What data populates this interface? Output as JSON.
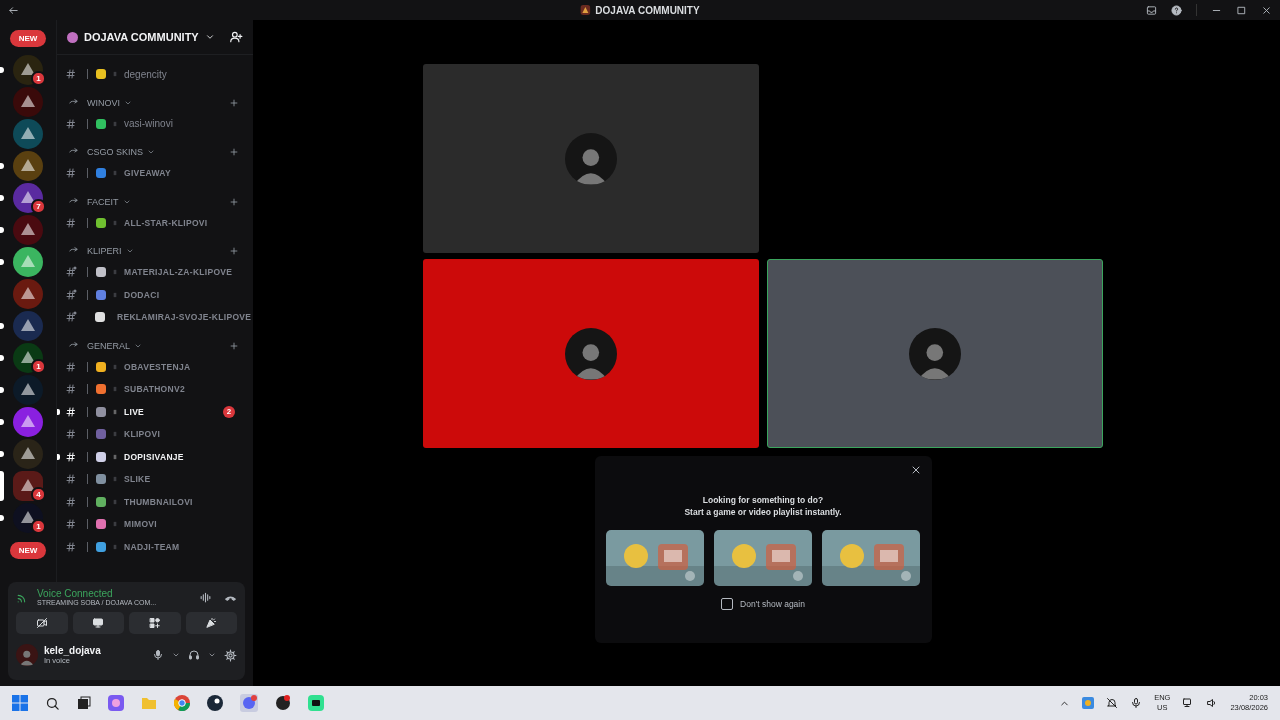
{
  "window": {
    "title": "DOJAVA COMMUNITY"
  },
  "servers": [
    {
      "kind": "new",
      "label": "NEW"
    },
    {
      "kind": "server",
      "color": "#2a2410",
      "badge": "1",
      "unread": true,
      "selected": false
    },
    {
      "kind": "server",
      "color": "#3a0a0a",
      "unread": false,
      "selected": false
    },
    {
      "kind": "server",
      "color": "#0e4a58",
      "unread": false,
      "selected": false
    },
    {
      "kind": "server",
      "color": "#5a4010",
      "unread": true,
      "selected": false
    },
    {
      "kind": "server",
      "color": "#5a2aa0",
      "badge": "7",
      "unread": true,
      "selected": false
    },
    {
      "kind": "server",
      "color": "#4a0a10",
      "unread": true,
      "selected": false
    },
    {
      "kind": "server",
      "color": "#3bb560",
      "unread": true,
      "selected": false
    },
    {
      "kind": "server",
      "color": "#6a1a10",
      "unread": false,
      "selected": false
    },
    {
      "kind": "server",
      "color": "#1a2a50",
      "unread": true,
      "selected": false
    },
    {
      "kind": "server",
      "color": "#0a3a14",
      "badge": "1",
      "unread": true,
      "selected": false
    },
    {
      "kind": "server",
      "color": "#0c1a28",
      "unread": true,
      "selected": false
    },
    {
      "kind": "server",
      "color": "#8a20e0",
      "unread": true,
      "selected": false
    },
    {
      "kind": "server",
      "color": "#2a2418",
      "unread": true,
      "selected": false
    },
    {
      "kind": "server",
      "color": "#5a1a18",
      "badge": "4",
      "unread": false,
      "selected": true
    },
    {
      "kind": "server",
      "color": "#0e1020",
      "badge": "1",
      "unread": true,
      "selected": false
    },
    {
      "kind": "new",
      "label": "NEW"
    }
  ],
  "guild": {
    "name": "DOJAVA COMMUNITY"
  },
  "groups": [
    {
      "channels": [
        {
          "name": "degencity",
          "color": "#e8c020",
          "caps": false,
          "locked": false,
          "unread": false
        }
      ]
    },
    {
      "category": "WINOVI",
      "channels": [
        {
          "name": "vasi-winovi",
          "color": "#30c060",
          "caps": false,
          "locked": false,
          "unread": false
        }
      ]
    },
    {
      "category": "CSGO SKINS",
      "channels": [
        {
          "name": "GIVEAWAY",
          "color": "#3080e0",
          "caps": true,
          "locked": false,
          "unread": false
        }
      ]
    },
    {
      "category": "FACEIT",
      "channels": [
        {
          "name": "ALL-STAR-KLIPOVI",
          "color": "#70c030",
          "caps": true,
          "locked": false,
          "unread": false
        }
      ]
    },
    {
      "category": "KLIPERI",
      "channels": [
        {
          "name": "MATERIJAL-ZA-KLIPOVE",
          "color": "#c0c0c8",
          "caps": true,
          "locked": true,
          "unread": false
        },
        {
          "name": "DODACI",
          "color": "#6080e0",
          "caps": true,
          "locked": true,
          "unread": false
        },
        {
          "name": "REKLAMIRAJ-SVOJE-KLIPOVE",
          "color": "#e0e0e0",
          "caps": true,
          "locked": true,
          "unread": false
        }
      ]
    },
    {
      "category": "GENERAL",
      "channels": [
        {
          "name": "OBAVESTENJA",
          "color": "#f0b020",
          "caps": true,
          "locked": false,
          "unread": false
        },
        {
          "name": "SUBATHONV2",
          "color": "#f07030",
          "caps": true,
          "locked": false,
          "unread": false
        },
        {
          "name": "LIVE",
          "color": "#9090a0",
          "caps": true,
          "locked": false,
          "unread": true,
          "badge": "2"
        },
        {
          "name": "KLIPOVI",
          "color": "#7060a0",
          "caps": true,
          "locked": false,
          "unread": false
        },
        {
          "name": "DOPISIVANJE",
          "color": "#d0d0e8",
          "caps": true,
          "locked": false,
          "unread": true
        },
        {
          "name": "SLIKE",
          "color": "#8090a0",
          "caps": true,
          "locked": false,
          "unread": false
        },
        {
          "name": "THUMBNAILOVI",
          "color": "#60b060",
          "caps": true,
          "locked": false,
          "unread": false
        },
        {
          "name": "MIMOVI",
          "color": "#e070b0",
          "caps": true,
          "locked": false,
          "unread": false
        },
        {
          "name": "NADJI-TEAM",
          "color": "#40a0e0",
          "caps": true,
          "locked": false,
          "unread": false
        }
      ]
    }
  ],
  "voice": {
    "status": "Voice Connected",
    "channel": "STREAMING SOBA / DOJAVA COM..."
  },
  "user": {
    "name": "kele_dojava",
    "status": "In voice"
  },
  "tiles": [
    {
      "kind": "video",
      "color": "#2b2b2b",
      "speaking": false
    },
    {
      "kind": "empty"
    },
    {
      "kind": "video",
      "color": "#cc0a0a",
      "speaking": false
    },
    {
      "kind": "video",
      "color": "#4c5058",
      "speaking": true
    }
  ],
  "activity": {
    "title": "Looking for something to do?",
    "subtitle": "Start a game or video playlist instantly.",
    "dont_show": {
      "label": "Don't show again",
      "checked": false
    }
  },
  "taskbar": {
    "language": "ENG",
    "region": "US",
    "time": "20:03",
    "date": "23/08/2026"
  }
}
